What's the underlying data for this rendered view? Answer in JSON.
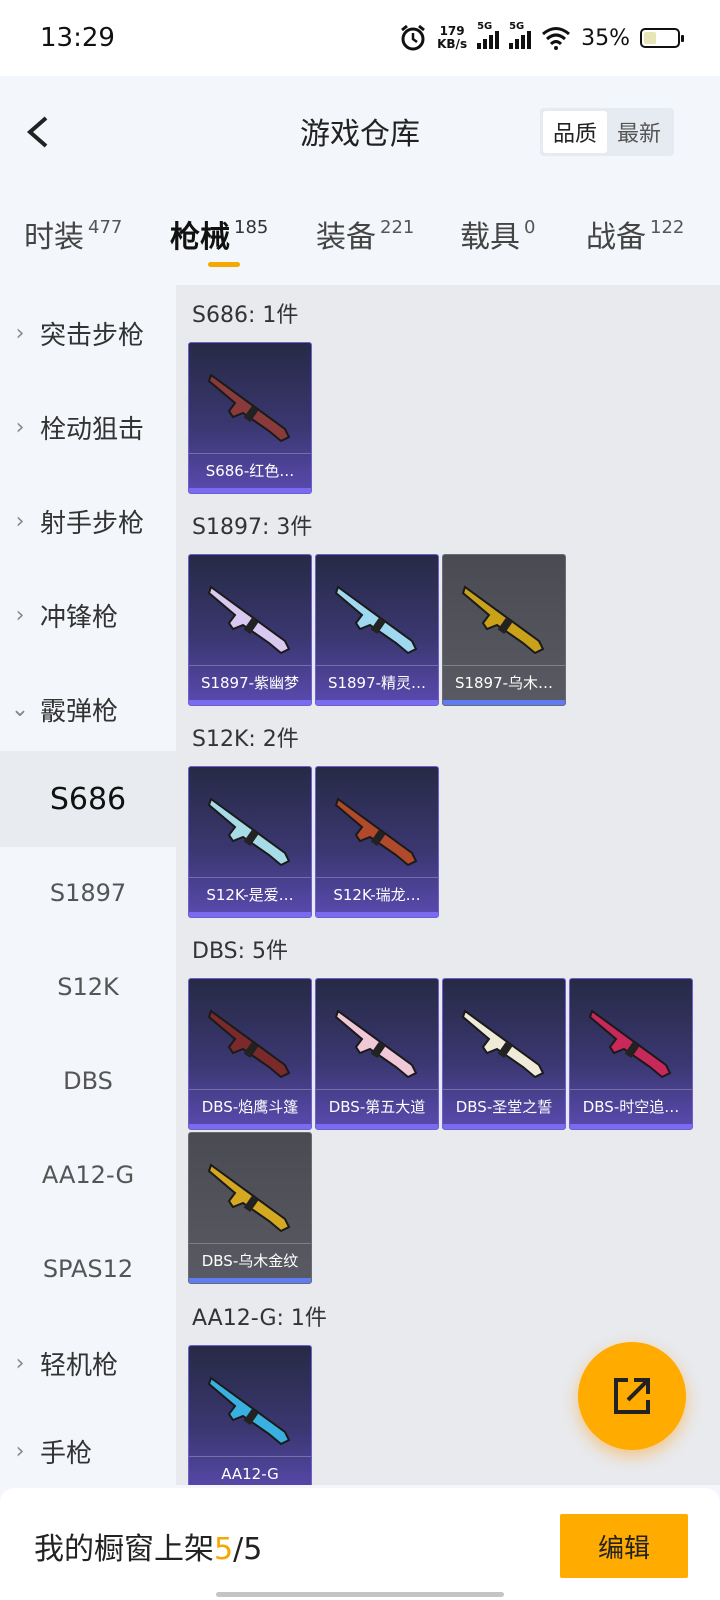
{
  "status_bar": {
    "time": "13:29",
    "net_speed_value": "179",
    "net_speed_unit": "KB/s",
    "signal1_label": "5G",
    "signal2_label": "5G",
    "battery_text": "35%",
    "battery_level": 0.35
  },
  "header": {
    "title": "游戏仓库",
    "sort_options": [
      "品质",
      "最新"
    ],
    "active_sort": "品质"
  },
  "tabs": [
    {
      "label": "时装",
      "count": "477",
      "active": false
    },
    {
      "label": "枪械",
      "count": "185",
      "active": true
    },
    {
      "label": "装备",
      "count": "221",
      "active": false
    },
    {
      "label": "载具",
      "count": "0",
      "active": false
    },
    {
      "label": "战备",
      "count": "122",
      "active": false
    }
  ],
  "sidebar": {
    "items": [
      {
        "label": "突击步枪",
        "type": "category",
        "expanded": false
      },
      {
        "label": "栓动狙击",
        "type": "category",
        "expanded": false
      },
      {
        "label": "射手步枪",
        "type": "category",
        "expanded": false
      },
      {
        "label": "冲锋枪",
        "type": "category",
        "expanded": false
      },
      {
        "label": "霰弹枪",
        "type": "category",
        "expanded": true
      },
      {
        "label": "S686",
        "type": "sub",
        "active": true
      },
      {
        "label": "S1897",
        "type": "sub",
        "active": false
      },
      {
        "label": "S12K",
        "type": "sub",
        "active": false
      },
      {
        "label": "DBS",
        "type": "sub",
        "active": false
      },
      {
        "label": "AA12-G",
        "type": "sub",
        "active": false
      },
      {
        "label": "SPAS12",
        "type": "sub",
        "active": false
      },
      {
        "label": "轻机枪",
        "type": "category",
        "expanded": false
      },
      {
        "label": "手枪",
        "type": "category",
        "expanded": false
      }
    ]
  },
  "groups": [
    {
      "title": "S686: 1件",
      "items": [
        {
          "name": "S686-红色…",
          "quality": "purple",
          "gun_color": "#8a3a3a"
        }
      ]
    },
    {
      "title": "S1897: 3件",
      "items": [
        {
          "name": "S1897-紫幽梦",
          "quality": "purple",
          "gun_color": "#d9c8f0"
        },
        {
          "name": "S1897-精灵…",
          "quality": "purple",
          "gun_color": "#9fd8f0"
        },
        {
          "name": "S1897-乌木…",
          "quality": "gray",
          "gun_color": "#c9a21a"
        }
      ]
    },
    {
      "title": "S12K: 2件",
      "items": [
        {
          "name": "S12K-是爱…",
          "quality": "purple",
          "gun_color": "#a8dbe8"
        },
        {
          "name": "S12K-瑞龙…",
          "quality": "purple",
          "gun_color": "#b04a2a"
        }
      ]
    },
    {
      "title": "DBS: 5件",
      "items": [
        {
          "name": "DBS-焰鹰斗篷",
          "quality": "purple",
          "gun_color": "#7a2a2a"
        },
        {
          "name": "DBS-第五大道",
          "quality": "purple",
          "gun_color": "#f0c8d8"
        },
        {
          "name": "DBS-圣堂之誓",
          "quality": "purple",
          "gun_color": "#f0ead8"
        },
        {
          "name": "DBS-时空追…",
          "quality": "purple",
          "gun_color": "#c8285a"
        },
        {
          "name": "DBS-乌木金纹",
          "quality": "gray",
          "gun_color": "#d4a820"
        }
      ]
    },
    {
      "title": "AA12-G: 1件",
      "items": [
        {
          "name": "AA12-G",
          "quality": "purple",
          "gun_color": "#3ab0e0"
        }
      ]
    }
  ],
  "bottom_bar": {
    "showcase_label": "我的橱窗上架",
    "showcase_current": "5",
    "showcase_total": "/5",
    "edit_label": "编辑"
  },
  "colors": {
    "accent": "#ffab00",
    "purple_card": "#5a4ab0",
    "gray_card": "#595a63"
  }
}
